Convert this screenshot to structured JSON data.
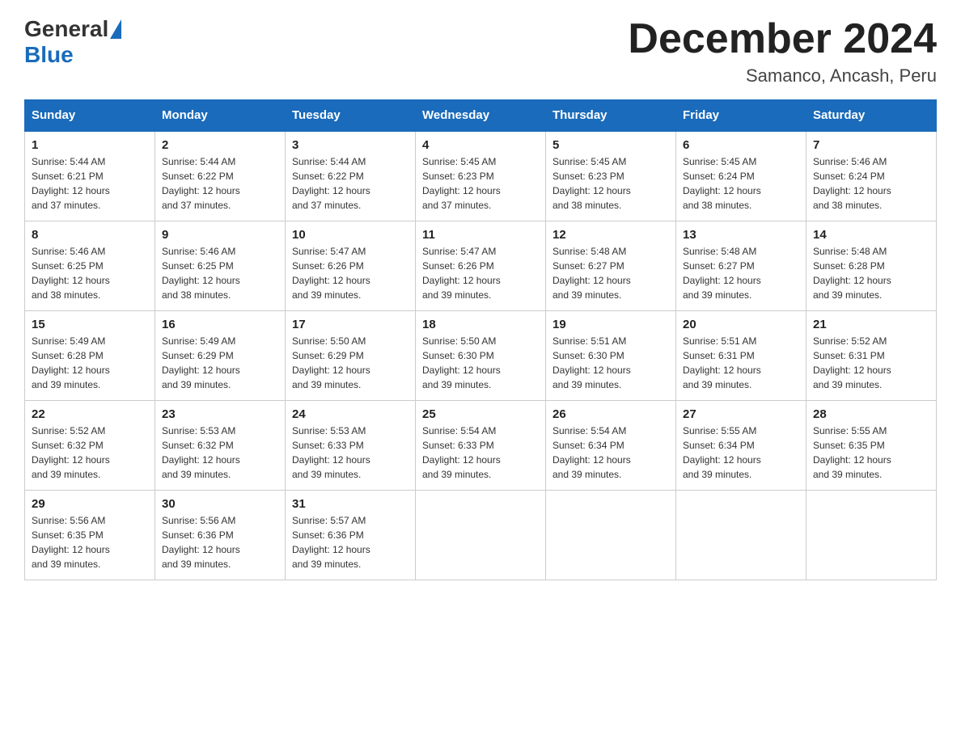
{
  "header": {
    "title": "December 2024",
    "location": "Samanco, Ancash, Peru",
    "logo": {
      "general": "General",
      "blue": "Blue"
    }
  },
  "days_of_week": [
    "Sunday",
    "Monday",
    "Tuesday",
    "Wednesday",
    "Thursday",
    "Friday",
    "Saturday"
  ],
  "weeks": [
    [
      {
        "day": "1",
        "sunrise": "5:44 AM",
        "sunset": "6:21 PM",
        "daylight": "12 hours and 37 minutes."
      },
      {
        "day": "2",
        "sunrise": "5:44 AM",
        "sunset": "6:22 PM",
        "daylight": "12 hours and 37 minutes."
      },
      {
        "day": "3",
        "sunrise": "5:44 AM",
        "sunset": "6:22 PM",
        "daylight": "12 hours and 37 minutes."
      },
      {
        "day": "4",
        "sunrise": "5:45 AM",
        "sunset": "6:23 PM",
        "daylight": "12 hours and 37 minutes."
      },
      {
        "day": "5",
        "sunrise": "5:45 AM",
        "sunset": "6:23 PM",
        "daylight": "12 hours and 38 minutes."
      },
      {
        "day": "6",
        "sunrise": "5:45 AM",
        "sunset": "6:24 PM",
        "daylight": "12 hours and 38 minutes."
      },
      {
        "day": "7",
        "sunrise": "5:46 AM",
        "sunset": "6:24 PM",
        "daylight": "12 hours and 38 minutes."
      }
    ],
    [
      {
        "day": "8",
        "sunrise": "5:46 AM",
        "sunset": "6:25 PM",
        "daylight": "12 hours and 38 minutes."
      },
      {
        "day": "9",
        "sunrise": "5:46 AM",
        "sunset": "6:25 PM",
        "daylight": "12 hours and 38 minutes."
      },
      {
        "day": "10",
        "sunrise": "5:47 AM",
        "sunset": "6:26 PM",
        "daylight": "12 hours and 39 minutes."
      },
      {
        "day": "11",
        "sunrise": "5:47 AM",
        "sunset": "6:26 PM",
        "daylight": "12 hours and 39 minutes."
      },
      {
        "day": "12",
        "sunrise": "5:48 AM",
        "sunset": "6:27 PM",
        "daylight": "12 hours and 39 minutes."
      },
      {
        "day": "13",
        "sunrise": "5:48 AM",
        "sunset": "6:27 PM",
        "daylight": "12 hours and 39 minutes."
      },
      {
        "day": "14",
        "sunrise": "5:48 AM",
        "sunset": "6:28 PM",
        "daylight": "12 hours and 39 minutes."
      }
    ],
    [
      {
        "day": "15",
        "sunrise": "5:49 AM",
        "sunset": "6:28 PM",
        "daylight": "12 hours and 39 minutes."
      },
      {
        "day": "16",
        "sunrise": "5:49 AM",
        "sunset": "6:29 PM",
        "daylight": "12 hours and 39 minutes."
      },
      {
        "day": "17",
        "sunrise": "5:50 AM",
        "sunset": "6:29 PM",
        "daylight": "12 hours and 39 minutes."
      },
      {
        "day": "18",
        "sunrise": "5:50 AM",
        "sunset": "6:30 PM",
        "daylight": "12 hours and 39 minutes."
      },
      {
        "day": "19",
        "sunrise": "5:51 AM",
        "sunset": "6:30 PM",
        "daylight": "12 hours and 39 minutes."
      },
      {
        "day": "20",
        "sunrise": "5:51 AM",
        "sunset": "6:31 PM",
        "daylight": "12 hours and 39 minutes."
      },
      {
        "day": "21",
        "sunrise": "5:52 AM",
        "sunset": "6:31 PM",
        "daylight": "12 hours and 39 minutes."
      }
    ],
    [
      {
        "day": "22",
        "sunrise": "5:52 AM",
        "sunset": "6:32 PM",
        "daylight": "12 hours and 39 minutes."
      },
      {
        "day": "23",
        "sunrise": "5:53 AM",
        "sunset": "6:32 PM",
        "daylight": "12 hours and 39 minutes."
      },
      {
        "day": "24",
        "sunrise": "5:53 AM",
        "sunset": "6:33 PM",
        "daylight": "12 hours and 39 minutes."
      },
      {
        "day": "25",
        "sunrise": "5:54 AM",
        "sunset": "6:33 PM",
        "daylight": "12 hours and 39 minutes."
      },
      {
        "day": "26",
        "sunrise": "5:54 AM",
        "sunset": "6:34 PM",
        "daylight": "12 hours and 39 minutes."
      },
      {
        "day": "27",
        "sunrise": "5:55 AM",
        "sunset": "6:34 PM",
        "daylight": "12 hours and 39 minutes."
      },
      {
        "day": "28",
        "sunrise": "5:55 AM",
        "sunset": "6:35 PM",
        "daylight": "12 hours and 39 minutes."
      }
    ],
    [
      {
        "day": "29",
        "sunrise": "5:56 AM",
        "sunset": "6:35 PM",
        "daylight": "12 hours and 39 minutes."
      },
      {
        "day": "30",
        "sunrise": "5:56 AM",
        "sunset": "6:36 PM",
        "daylight": "12 hours and 39 minutes."
      },
      {
        "day": "31",
        "sunrise": "5:57 AM",
        "sunset": "6:36 PM",
        "daylight": "12 hours and 39 minutes."
      },
      null,
      null,
      null,
      null
    ]
  ],
  "labels": {
    "sunrise": "Sunrise:",
    "sunset": "Sunset:",
    "daylight": "Daylight:"
  }
}
